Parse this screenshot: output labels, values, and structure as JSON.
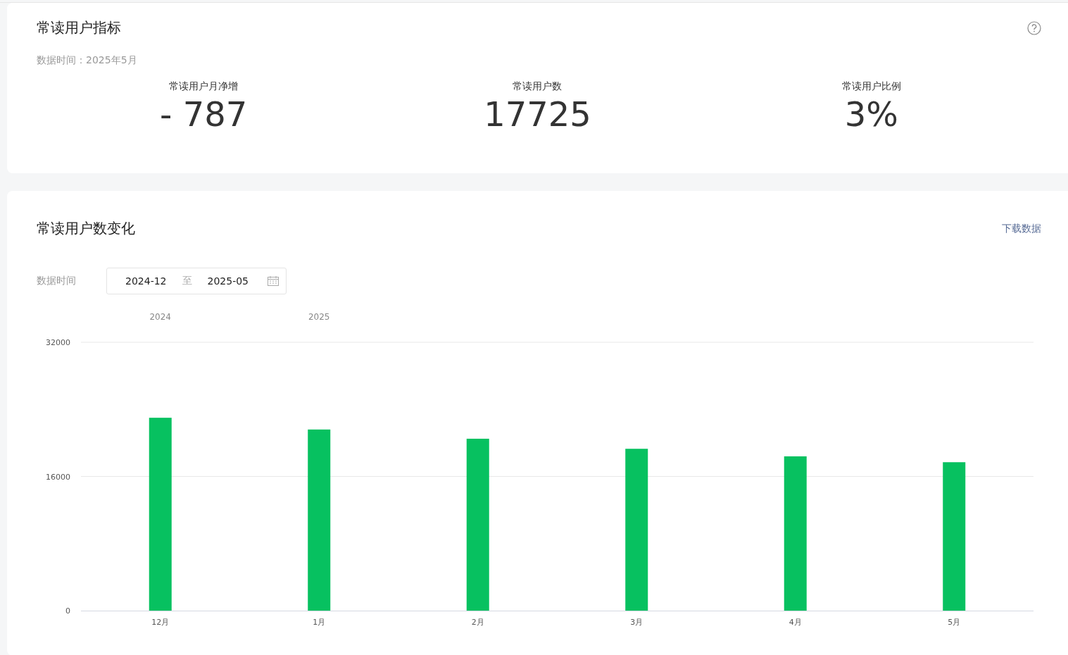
{
  "metrics_card": {
    "title": "常读用户指标",
    "data_time": "数据时间：2025年5月",
    "metrics": [
      {
        "label": "常读用户月净增",
        "value": "- 787"
      },
      {
        "label": "常读用户数",
        "value": "17725"
      },
      {
        "label": "常读用户比例",
        "value": "3%"
      }
    ]
  },
  "trend_card": {
    "title": "常读用户数变化",
    "download_link": "下载数据",
    "date_filter": {
      "label": "数据时间",
      "start": "2024-12",
      "separator": "至",
      "end": "2025-05"
    },
    "chart_data": {
      "type": "bar",
      "categories": [
        "12月",
        "1月",
        "2月",
        "3月",
        "4月",
        "5月"
      ],
      "series": [
        {
          "color": "#07c160",
          "values": [
            23000,
            21600,
            20500,
            19300,
            18400,
            17700
          ]
        }
      ],
      "ylim": [
        0,
        32000
      ],
      "yticks": [
        0,
        16000,
        32000
      ],
      "annotations": [
        "2024",
        "2025"
      ]
    }
  }
}
